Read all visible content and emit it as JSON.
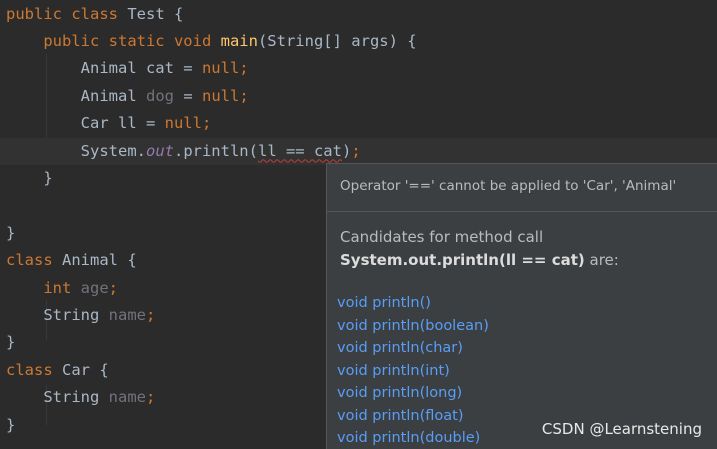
{
  "editor": {
    "lines": [
      {
        "code": [
          {
            "t": "public class ",
            "c": "kw"
          },
          {
            "t": "Test {",
            "c": ""
          }
        ]
      },
      {
        "code": [
          {
            "t": "    ",
            "c": ""
          },
          {
            "t": "public static void ",
            "c": "kw"
          },
          {
            "t": "main",
            "c": "fn"
          },
          {
            "t": "(String[] args) {",
            "c": ""
          }
        ]
      },
      {
        "code": [
          {
            "t": "        Animal cat = ",
            "c": ""
          },
          {
            "t": "null",
            "c": "kw"
          },
          {
            "t": ";",
            "c": "kw"
          }
        ]
      },
      {
        "code": [
          {
            "t": "        Animal ",
            "c": ""
          },
          {
            "t": "dog",
            "c": "unused"
          },
          {
            "t": " = ",
            "c": ""
          },
          {
            "t": "null",
            "c": "kw"
          },
          {
            "t": ";",
            "c": "kw"
          }
        ]
      },
      {
        "code": [
          {
            "t": "        Car ll = ",
            "c": ""
          },
          {
            "t": "null",
            "c": "kw"
          },
          {
            "t": ";",
            "c": "kw"
          }
        ]
      },
      {
        "code": [
          {
            "t": "        System.",
            "c": ""
          },
          {
            "t": "out",
            "c": "field"
          },
          {
            "t": ".println(",
            "c": ""
          },
          {
            "t": "ll == cat",
            "c": "warn"
          },
          {
            "t": ")",
            "c": ""
          },
          {
            "t": ";",
            "c": "kw"
          }
        ],
        "current": true
      },
      {
        "code": [
          {
            "t": "    }",
            "c": ""
          }
        ]
      },
      {
        "code": []
      },
      {
        "code": [
          {
            "t": "}",
            "c": ""
          }
        ]
      },
      {
        "code": [
          {
            "t": "class ",
            "c": "kw"
          },
          {
            "t": "Animal {",
            "c": ""
          }
        ]
      },
      {
        "code": [
          {
            "t": "    ",
            "c": ""
          },
          {
            "t": "int ",
            "c": "kw"
          },
          {
            "t": "age",
            "c": "unused"
          },
          {
            "t": ";",
            "c": "kw"
          }
        ]
      },
      {
        "code": [
          {
            "t": "    String ",
            "c": ""
          },
          {
            "t": "name",
            "c": "unused"
          },
          {
            "t": ";",
            "c": "kw"
          }
        ]
      },
      {
        "code": [
          {
            "t": "}",
            "c": ""
          }
        ]
      },
      {
        "code": [
          {
            "t": "class ",
            "c": "kw"
          },
          {
            "t": "Car {",
            "c": ""
          }
        ]
      },
      {
        "code": [
          {
            "t": "    String ",
            "c": ""
          },
          {
            "t": "name",
            "c": "unused"
          },
          {
            "t": ";",
            "c": "kw"
          }
        ]
      },
      {
        "code": [
          {
            "t": "}",
            "c": ""
          }
        ]
      }
    ]
  },
  "popup": {
    "error_message": "Operator '==' cannot be applied to 'Car', 'Animal'",
    "candidates_prefix": "Candidates for method call ",
    "candidates_call": "System.out.println(ll == cat)",
    "candidates_suffix": " are:",
    "methods": [
      "void println()",
      "void println(boolean)",
      "void println(char)",
      "void println(int)",
      "void println(long)",
      "void println(float)",
      "void println(double)"
    ]
  },
  "watermark": "CSDN @Learnstening",
  "colors": {
    "background": "#2b2b2b",
    "keyword": "#cc7832",
    "method_decl": "#ffc66d",
    "static_field": "#9876aa",
    "unused": "#72737a",
    "link": "#589df6",
    "error_underline": "#bc3f3c"
  }
}
